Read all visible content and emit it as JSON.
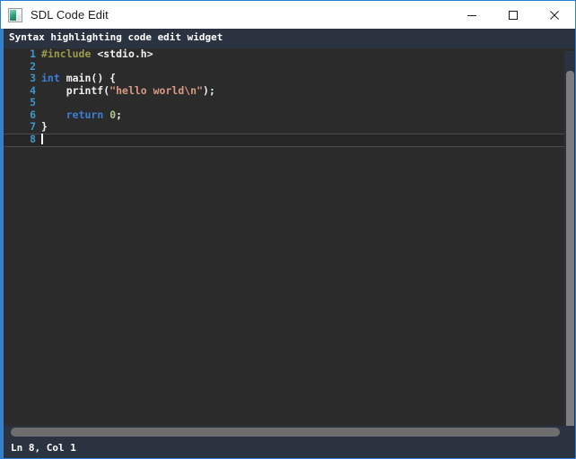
{
  "window": {
    "title": "SDL Code Edit",
    "icon": "app-window-icon",
    "border_color": "#2f7fd4",
    "controls": [
      {
        "name": "minimize",
        "glyph": "minimize-icon"
      },
      {
        "name": "maximize",
        "glyph": "maximize-icon"
      },
      {
        "name": "close",
        "glyph": "close-icon"
      }
    ]
  },
  "widget": {
    "header_title": "Syntax highlighting code edit widget",
    "accent_color": "#3a7fbf",
    "background_color": "#2b2b2b",
    "gutter_color": "#3d97c9"
  },
  "editor": {
    "lines": [
      {
        "num": "1",
        "tokens": [
          {
            "t": "#include",
            "c": "pp"
          },
          {
            "t": " ",
            "c": "plain"
          },
          {
            "t": "<stdio.h>",
            "c": "inc"
          }
        ]
      },
      {
        "num": "2",
        "tokens": []
      },
      {
        "num": "3",
        "tokens": [
          {
            "t": "int",
            "c": "kw"
          },
          {
            "t": " main() {",
            "c": "plain"
          }
        ]
      },
      {
        "num": "4",
        "tokens": [
          {
            "t": "    printf(",
            "c": "plain"
          },
          {
            "t": "\"hello world\\n\"",
            "c": "str"
          },
          {
            "t": ");",
            "c": "plain"
          }
        ]
      },
      {
        "num": "5",
        "tokens": []
      },
      {
        "num": "6",
        "tokens": [
          {
            "t": "    ",
            "c": "plain"
          },
          {
            "t": "return",
            "c": "kw"
          },
          {
            "t": " ",
            "c": "plain"
          },
          {
            "t": "0",
            "c": "num"
          },
          {
            "t": ";",
            "c": "plain"
          }
        ]
      },
      {
        "num": "7",
        "tokens": [
          {
            "t": "}",
            "c": "plain"
          }
        ]
      },
      {
        "num": "8",
        "tokens": [],
        "current": true,
        "caret": true
      }
    ]
  },
  "scrollbars": {
    "vertical_name": "vertical-scrollbar",
    "horizontal_name": "horizontal-scrollbar"
  },
  "statusbar": {
    "text": "Ln 8, Col 1"
  }
}
